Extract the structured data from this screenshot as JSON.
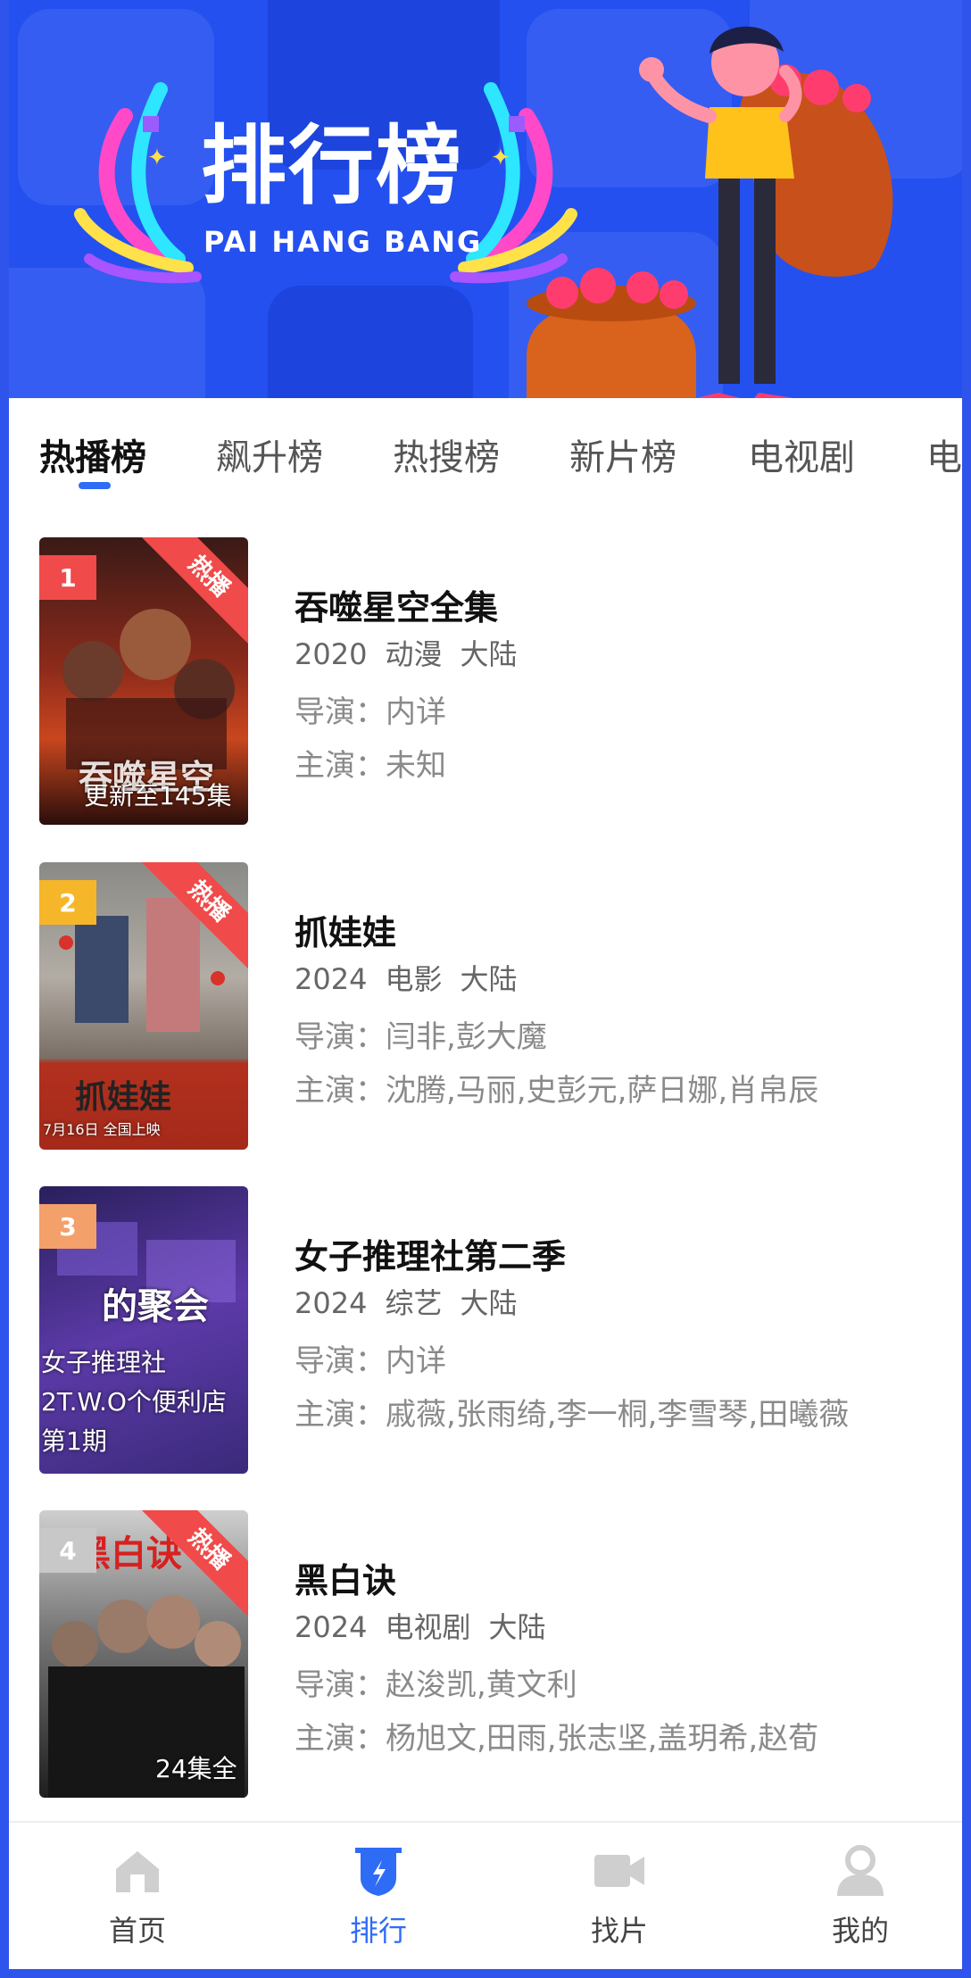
{
  "banner": {
    "title": "排行榜",
    "subtitle": "PAI HANG BANG"
  },
  "tabs": [
    "热播榜",
    "飙升榜",
    "热搜榜",
    "新片榜",
    "电视剧",
    "电"
  ],
  "items": [
    {
      "rank": "1",
      "ribbon": "热播",
      "poster_text": "吞噬星空",
      "poster_caption": "更新至145集",
      "title": "吞噬星空全集",
      "year": "2020",
      "genre": "动漫",
      "region": "大陆",
      "director": "导演：内详",
      "cast": "主演：未知"
    },
    {
      "rank": "2",
      "ribbon": "热播",
      "poster_text": "抓娃娃",
      "poster_caption": "7月16日 全国上映",
      "title": "抓娃娃",
      "year": "2024",
      "genre": "电影",
      "region": "大陆",
      "director": "导演：闫非,彭大魔",
      "cast": "主演：沈腾,马丽,史彭元,萨日娜,肖帛辰"
    },
    {
      "rank": "3",
      "poster_text": "的聚会",
      "poster_caption_lines": [
        "女子推理社",
        "2T.W.O个便利店",
        "第1期"
      ],
      "title": "女子推理社第二季",
      "year": "2024",
      "genre": "综艺",
      "region": "大陆",
      "director": "导演：内详",
      "cast": "主演：戚薇,张雨绮,李一桐,李雪琴,田曦薇"
    },
    {
      "rank": "4",
      "ribbon": "热播",
      "poster_text": "黑白诀",
      "poster_caption": "24集全",
      "title": "黑白诀",
      "year": "2024",
      "genre": "电视剧",
      "region": "大陆",
      "director": "导演：赵浚凯,黄文利",
      "cast": "主演：杨旭文,田雨,张志坚,盖玥希,赵荀"
    }
  ],
  "nav": [
    {
      "label": "首页",
      "icon": "home-icon"
    },
    {
      "label": "排行",
      "icon": "ranking-icon"
    },
    {
      "label": "找片",
      "icon": "video-camera-icon"
    },
    {
      "label": "我的",
      "icon": "user-icon"
    }
  ],
  "colors": {
    "primary": "#2f6cf6",
    "banner": "#2450f0",
    "ribbon": "#f04a4a"
  }
}
